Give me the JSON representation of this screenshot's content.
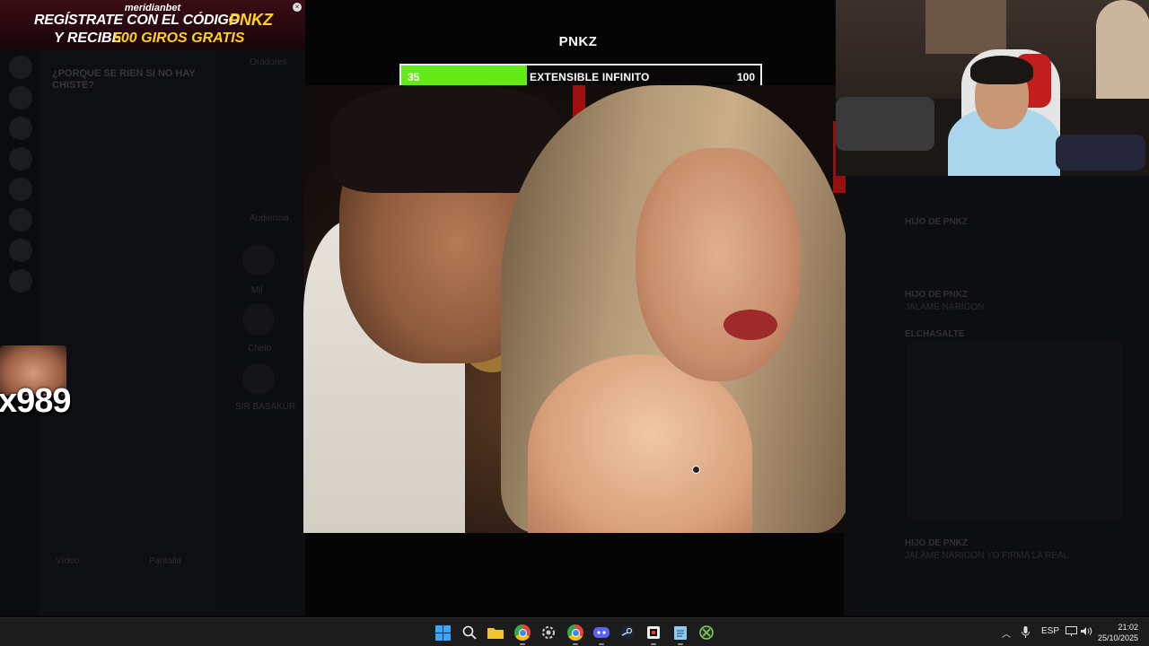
{
  "promo": {
    "brand": "meridianbet",
    "line1": "REGÍSTRATE CON EL CÓDIGO",
    "code": "PNKZ",
    "line2_prefix": "Y RECIBE",
    "line2_highlight": "500 GIROS GRATIS",
    "close_icon": "close-icon"
  },
  "stream": {
    "logo": "PNKZ"
  },
  "progress": {
    "current": "35",
    "label": "EXTENSIBLE INFINITO",
    "max": "100",
    "fraction": 0.35,
    "fill_color": "#63ea17"
  },
  "discord": {
    "chat_title": "¿PORQUE SE RIEN SI NO HAY CHISTE?",
    "voice_label": "Oradores",
    "audience_label": "Audiencia",
    "audience": [
      "Mil",
      "Chelo",
      "SIR BASAKUR"
    ],
    "buttons": [
      "Vídeo",
      "Pantalla"
    ],
    "messages": [
      {
        "author": "HIJO DE PNKZ",
        "body": "JALAME NARIGON"
      },
      {
        "author": "ELCHASALTE",
        "body": ""
      },
      {
        "author": "HIJO DE PNKZ",
        "body": "JALAME NARIGON YO FIRMA LA REAL"
      }
    ]
  },
  "emote": {
    "count": "x989"
  },
  "taskbar": {
    "icons": [
      "windows-icon",
      "search-icon",
      "folder-icon",
      "chrome-icon",
      "settings-icon",
      "chrome-icon",
      "discord-icon",
      "steam-icon",
      "capcut-icon",
      "notepad-icon",
      "xbox-icon"
    ],
    "tray_lang": "ESP",
    "time": "21:02",
    "date": "25/10/2025"
  }
}
